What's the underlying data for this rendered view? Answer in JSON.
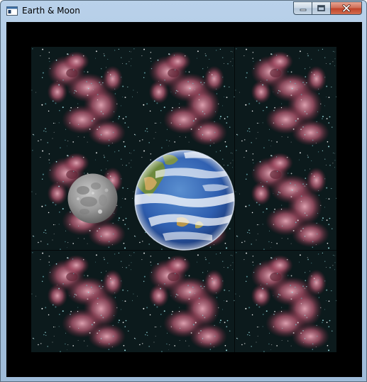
{
  "window": {
    "title": "Earth & Moon",
    "app_icon": "window-app-icon",
    "buttons": {
      "minimize": "minimize-icon",
      "maximize": "maximize-icon",
      "close": "close-icon"
    }
  },
  "scene": {
    "background_color": "#000000",
    "tile_grid": {
      "rows": 3,
      "cols": 3,
      "image": "nebula-starfield"
    },
    "bodies": [
      {
        "name": "moon",
        "image": "moon-sprite"
      },
      {
        "name": "earth",
        "image": "earth-sprite"
      }
    ]
  }
}
